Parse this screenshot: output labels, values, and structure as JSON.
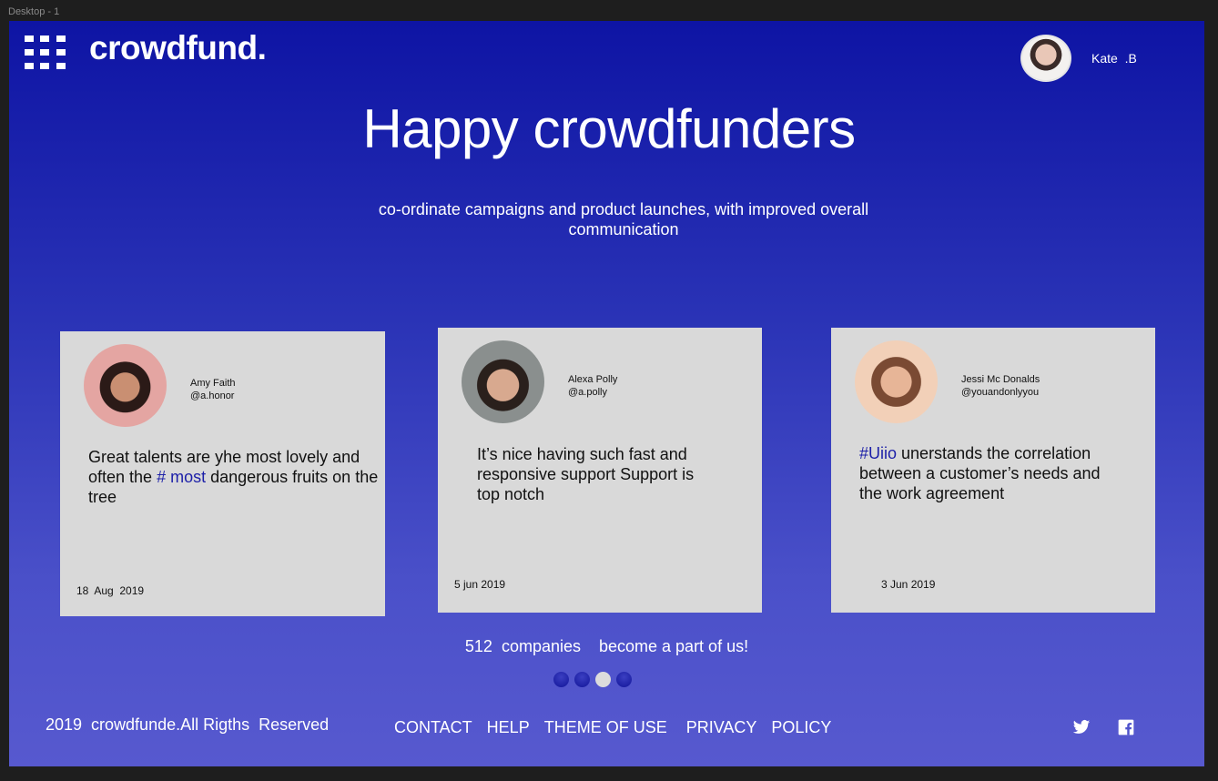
{
  "frame_label": "Desktop - 1",
  "header": {
    "brand": "crowdfund.",
    "user_name": "Kate  .B"
  },
  "hero": {
    "title": "Happy crowdfunders",
    "subtitle": "co-ordinate campaigns and product launches, with improved overall communication"
  },
  "testimonials": [
    {
      "name": "Amy Faith",
      "handle": "@a.honor",
      "quote_before": "Great talents are yhe most lovely and often the ",
      "quote_tag": "# most",
      "quote_after": " dangerous fruits on the tree",
      "date": "18  Aug  2019"
    },
    {
      "name": "Alexa Polly",
      "handle": "@a.polly",
      "quote_before": "It’s nice having such fast and responsive support Support is top notch",
      "quote_tag": "",
      "quote_after": "",
      "date": "5 jun 2019"
    },
    {
      "name": "Jessi Mc Donalds",
      "handle": "@youandonlyyou",
      "quote_before": "",
      "quote_tag": "#Uiio",
      "quote_after": " unerstands the correlation  between a customer’s needs and the work agreement",
      "date": "3 Jun 2019"
    }
  ],
  "stats": {
    "text": "512  companies    become a part of us!"
  },
  "pager": {
    "count": 4,
    "active_index": 2
  },
  "footer": {
    "copyright": "2019  crowdfunde.All Rigths  Reserved",
    "links": [
      "CONTACT",
      "HELP",
      "THEME OF USE",
      "PRIVACY",
      "POLICY"
    ],
    "social": [
      "twitter-icon",
      "facebook-icon"
    ]
  },
  "colors": {
    "background_top": "#0e14a4",
    "background_bottom": "#5759cf",
    "card": "#d9d9d9",
    "tag": "#1c1fa8"
  }
}
